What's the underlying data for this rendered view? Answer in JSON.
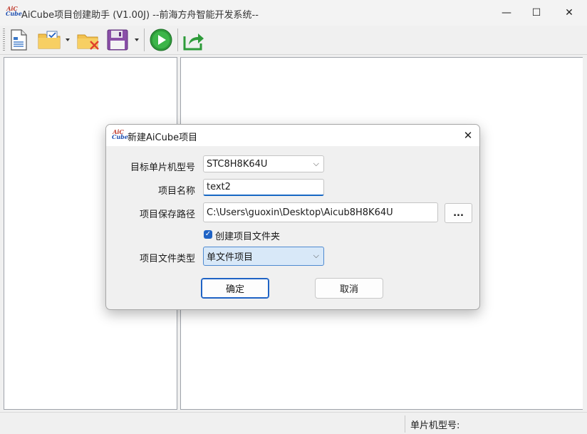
{
  "window": {
    "title": "AiCube项目创建助手 (V1.00J) --前海方舟智能开发系统--",
    "logo_top": "AiC",
    "logo_bottom": "Cube",
    "minimize_icon": "—",
    "maximize_icon": "☐",
    "close_icon": "✕"
  },
  "toolbar": {
    "items": [
      "new-file-icon",
      "open-folder-icon",
      "delete-folder-icon",
      "save-disk-icon",
      "run-play-icon",
      "export-share-icon"
    ]
  },
  "status_bar": {
    "label": "单片机型号:"
  },
  "dialog": {
    "title": "新建AiCube项目",
    "logo_top": "AiC",
    "logo_bottom": "Cube",
    "close_icon": "✕",
    "mcu_label": "目标单片机型号",
    "mcu_value": "STC8H8K64U",
    "name_label": "项目名称",
    "name_value": "text2",
    "path_label": "项目保存路径",
    "path_value": "C:\\Users\\guoxin\\Desktop\\Aicub8H8K64U",
    "browse_label": "...",
    "create_folder_label": "创建项目文件夹",
    "create_folder_checked": true,
    "type_label": "项目文件类型",
    "type_value": "单文件项目",
    "ok_label": "确定",
    "cancel_label": "取消",
    "dropdown_icon": "⌵"
  }
}
